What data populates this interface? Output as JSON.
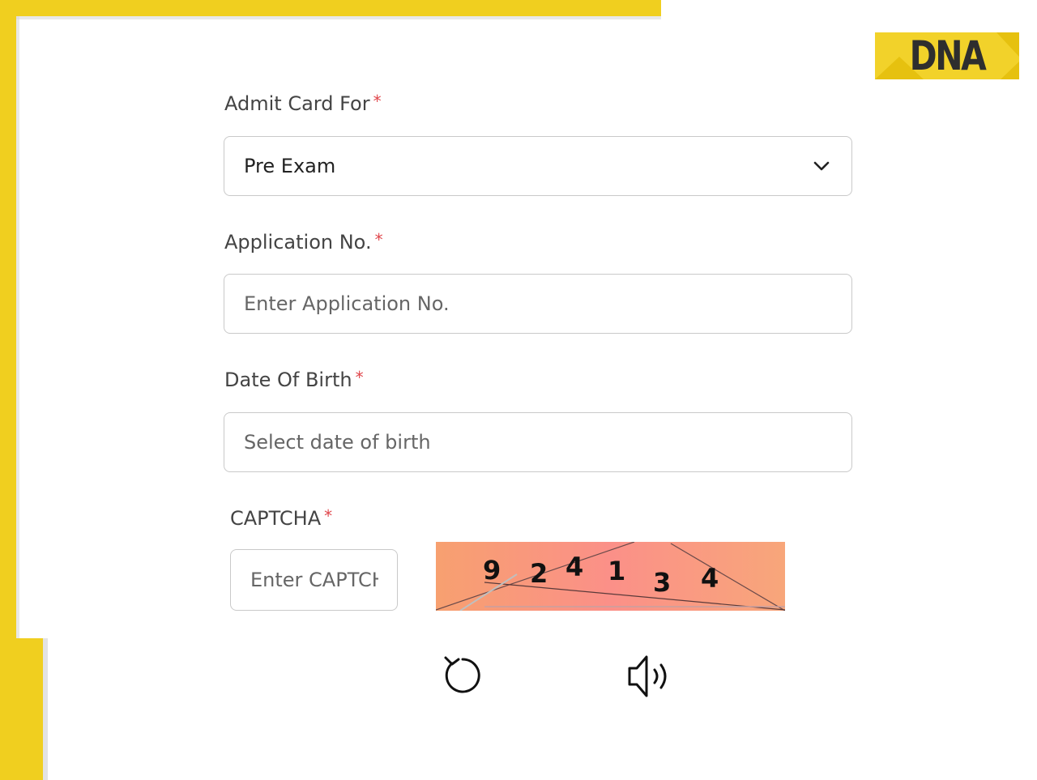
{
  "logo": {
    "text": "DNA",
    "icon": "dna-logo"
  },
  "form": {
    "admit_card": {
      "label": "Admit Card For",
      "required": "*",
      "value": "Pre Exam",
      "icon": "chevron-down-icon"
    },
    "application_no": {
      "label": "Application No.",
      "required": "*",
      "placeholder": "Enter Application No."
    },
    "dob": {
      "label": "Date Of Birth",
      "required": "*",
      "placeholder": "Select date of birth"
    },
    "captcha": {
      "label": "CAPTCHA",
      "required": "*",
      "placeholder": "Enter CAPTCHA",
      "digits": [
        "9",
        "2",
        "4",
        "1",
        "3",
        "4"
      ],
      "refresh_icon": "refresh-icon",
      "audio_icon": "speaker-icon"
    }
  },
  "colors": {
    "frame": "#f0cf1f",
    "required": "#e0474c",
    "captcha_bg": "#f5a07c"
  }
}
